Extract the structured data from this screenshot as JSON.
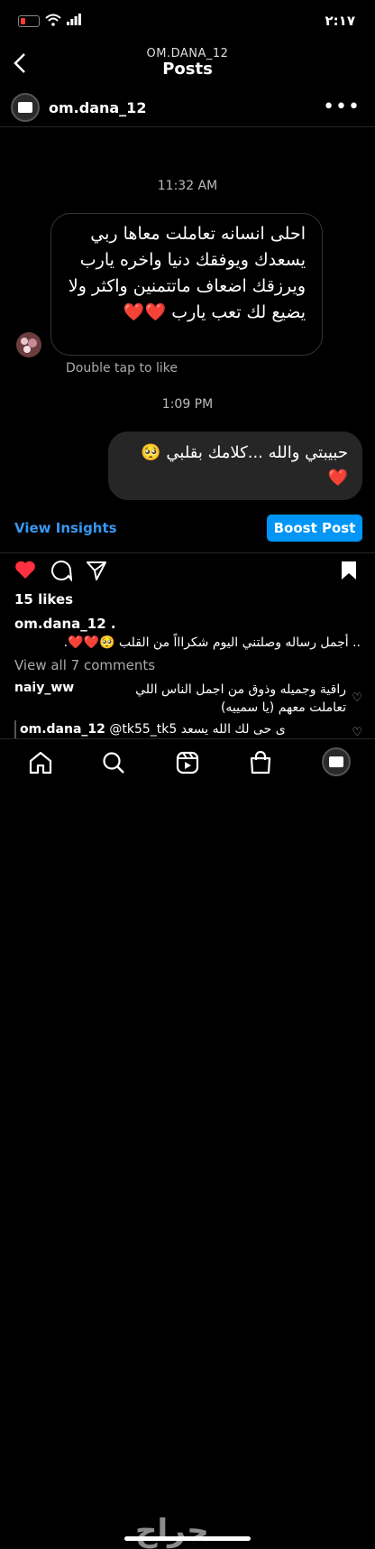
{
  "status_bar": {
    "time": "٢:١٧"
  },
  "header": {
    "account": "OM.DANA_12",
    "title": "Posts",
    "back_icon": "chevron-left-icon"
  },
  "post_owner": {
    "username": "om.dana_12",
    "more_label": "•••"
  },
  "thread": {
    "timestamp1": "11:32 AM",
    "incoming_message": "احلى انسانه تعاملت معاها ربي يسعدك ويوفقك دنيا واخره يارب ويرزقك اضعاف ماتتمنين واكثر ولا يضيع لك تعب يارب ❤️❤️",
    "double_tap": "Double tap to like",
    "timestamp2": "1:09 PM",
    "outgoing_message": "حبيبتي والله ...كلامك بقلبي 🥺❤️"
  },
  "actions": {
    "view_insights": "View Insights",
    "boost_post": "Boost Post"
  },
  "post": {
    "likes": "15 likes",
    "caption_user": "om.dana_12 .",
    "caption": ".. أجمل رساله وصلتني اليوم شكراااً من القلب 🥺❤️❤️.",
    "view_all": "View all 7 comments",
    "comment1_user": "naiy_ww",
    "comment1_text": "راقية وجميله وذوق من اجمل الناس اللي تعاملت معهم (يا سمييه)",
    "comment2_user": "om.dana_12",
    "comment2_mention": "@tk55_tk5",
    "comment2_text": "ى حى لك الله يسعد"
  },
  "nav": {
    "items": [
      "home-icon",
      "search-icon",
      "reels-icon",
      "shop-icon",
      "profile-avatar"
    ]
  },
  "watermark": "حراج",
  "colors": {
    "accent": "#0095f6",
    "link": "#3897f0",
    "like": "#ff3040"
  }
}
